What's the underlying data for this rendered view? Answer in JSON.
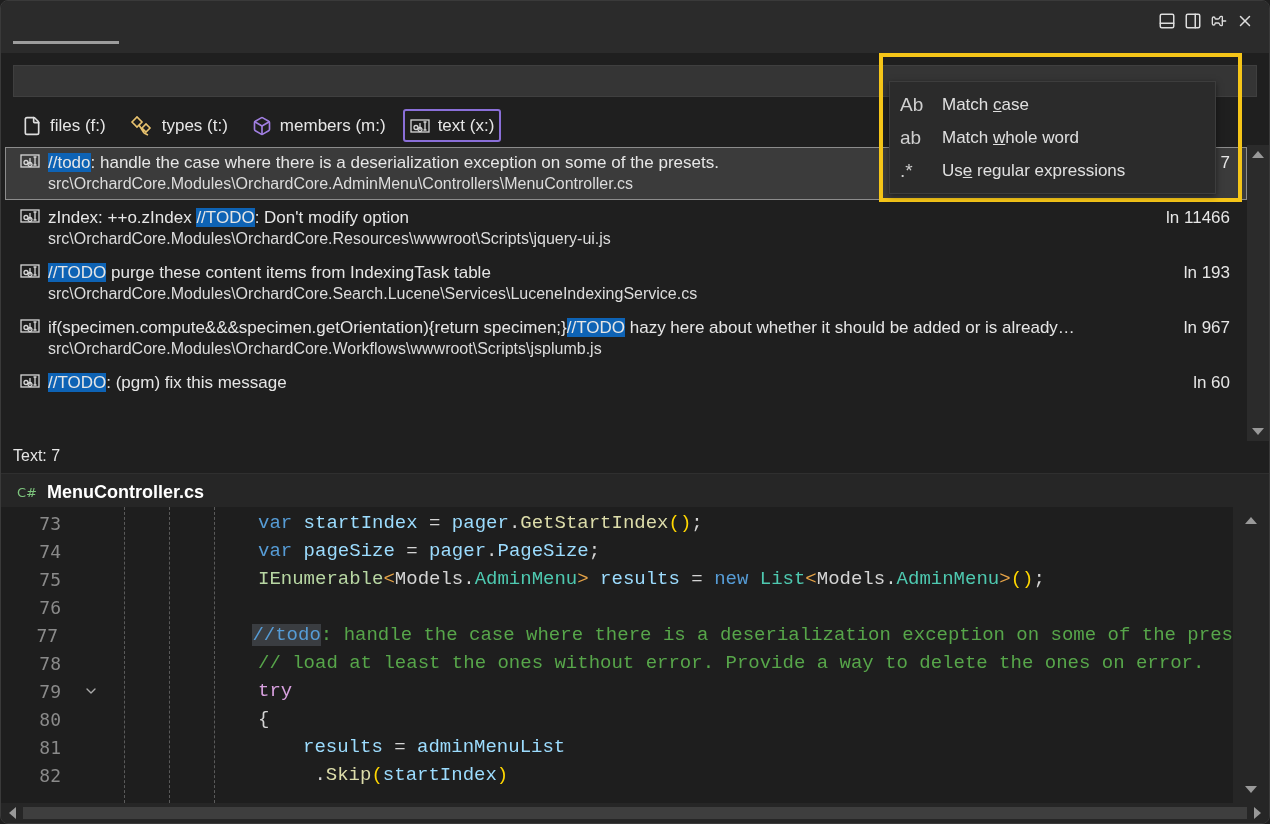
{
  "filters": [
    {
      "kind": "files",
      "label": "files (f:)",
      "selected": false
    },
    {
      "kind": "types",
      "label": "types (t:)",
      "selected": false
    },
    {
      "kind": "members",
      "label": "members (m:)",
      "selected": false
    },
    {
      "kind": "text",
      "label": "text (x:)",
      "selected": true
    }
  ],
  "results": [
    {
      "selected": true,
      "parts": [
        {
          "text": "//todo",
          "match": true
        },
        {
          "text": ": handle the case where there is a deserialization exception on some of the presets.",
          "match": false
        }
      ],
      "path": "src\\OrchardCore.Modules\\OrchardCore.AdminMenu\\Controllers\\MenuController.cs",
      "line": "7"
    },
    {
      "selected": false,
      "parts": [
        {
          "text": "zIndex: ++o.zIndex ",
          "match": false
        },
        {
          "text": "//TODO",
          "match": true
        },
        {
          "text": ": Don't modify option",
          "match": false
        }
      ],
      "path": "src\\OrchardCore.Modules\\OrchardCore.Resources\\wwwroot\\Scripts\\jquery-ui.js",
      "line": "ln 11466"
    },
    {
      "selected": false,
      "parts": [
        {
          "text": "//TODO",
          "match": true
        },
        {
          "text": " purge these content items from IndexingTask table",
          "match": false
        }
      ],
      "path": "src\\OrchardCore.Modules\\OrchardCore.Search.Lucene\\Services\\LuceneIndexingService.cs",
      "line": "ln 193"
    },
    {
      "selected": false,
      "parts": [
        {
          "text": "if(specimen.compute&&&specimen.getOrientation){return specimen;}",
          "match": false
        },
        {
          "text": "//TODO",
          "match": true
        },
        {
          "text": " hazy here about whether it should be added or is already…",
          "match": false
        }
      ],
      "path": "src\\OrchardCore.Modules\\OrchardCore.Workflows\\wwwroot\\Scripts\\jsplumb.js",
      "line": "ln 967"
    },
    {
      "selected": false,
      "parts": [
        {
          "text": "//TODO",
          "match": true
        },
        {
          "text": ": (pgm) fix this message",
          "match": false
        }
      ],
      "line": "ln 60"
    }
  ],
  "status": "Text: 7",
  "editor": {
    "icon_label": "C#",
    "file": "MenuController.cs",
    "lines": [
      {
        "number": "73",
        "fold": false,
        "tokens": [
          {
            "kind": "keyword",
            "text": "var"
          },
          {
            "kind": "local",
            "text": " startIndex"
          },
          {
            "kind": "plain",
            "text": " = "
          },
          {
            "kind": "local",
            "text": "pager"
          },
          {
            "kind": "plain",
            "text": "."
          },
          {
            "kind": "method",
            "text": "GetStartIndex"
          },
          {
            "kind": "bracket",
            "text": "()"
          },
          {
            "kind": "plain",
            "text": ";"
          }
        ]
      },
      {
        "number": "74",
        "fold": false,
        "tokens": [
          {
            "kind": "keyword",
            "text": "var"
          },
          {
            "kind": "local",
            "text": " pageSize"
          },
          {
            "kind": "plain",
            "text": " = "
          },
          {
            "kind": "local",
            "text": "pager"
          },
          {
            "kind": "plain",
            "text": "."
          },
          {
            "kind": "local",
            "text": "PageSize"
          },
          {
            "kind": "plain",
            "text": ";"
          }
        ]
      },
      {
        "number": "75",
        "fold": false,
        "tokens": [
          {
            "kind": "interface",
            "text": "IEnumerable"
          },
          {
            "kind": "angle",
            "text": "<"
          },
          {
            "kind": "plain",
            "text": "Models."
          },
          {
            "kind": "type",
            "text": "AdminMenu"
          },
          {
            "kind": "angle",
            "text": ">"
          },
          {
            "kind": "local",
            "text": " results"
          },
          {
            "kind": "plain",
            "text": " = "
          },
          {
            "kind": "keyword",
            "text": "new"
          },
          {
            "kind": "type",
            "text": " List"
          },
          {
            "kind": "angle",
            "text": "<"
          },
          {
            "kind": "plain",
            "text": "Models."
          },
          {
            "kind": "type",
            "text": "AdminMenu"
          },
          {
            "kind": "angle",
            "text": ">"
          },
          {
            "kind": "bracket",
            "text": "()"
          },
          {
            "kind": "plain",
            "text": ";"
          }
        ]
      },
      {
        "number": "76",
        "fold": false
      },
      {
        "number": "77",
        "fold": false,
        "tokens": [
          {
            "kind": "match",
            "text": "//todo"
          },
          {
            "kind": "comment",
            "text": ": handle the case where there is a deserialization exception on some of the pres"
          }
        ]
      },
      {
        "number": "78",
        "fold": false,
        "tokens": [
          {
            "kind": "comment",
            "text": "// load at least the ones without error. Provide a way to delete the ones on error."
          }
        ]
      },
      {
        "number": "79",
        "fold": true,
        "tokens": [
          {
            "kind": "control",
            "text": "try"
          }
        ]
      },
      {
        "number": "80",
        "fold": false,
        "tokens": [
          {
            "kind": "plain",
            "text": "{"
          }
        ],
        "children": [
          {
            "number": "81",
            "fold": false,
            "tokens": [
              {
                "kind": "local",
                "text": "results"
              },
              {
                "kind": "plain",
                "text": " = "
              },
              {
                "kind": "local",
                "text": "adminMenuList"
              }
            ]
          },
          {
            "number": "82",
            "fold": false,
            "tokens": [
              {
                "kind": "plain",
                "text": " ."
              },
              {
                "kind": "method",
                "text": "Skip"
              },
              {
                "kind": "bracket",
                "text": "("
              },
              {
                "kind": "local",
                "text": "startIndex"
              },
              {
                "kind": "bracket",
                "text": ")"
              }
            ]
          }
        ]
      }
    ]
  },
  "options_menu": [
    {
      "glyph": "Ab",
      "before": "Match ",
      "key": "c",
      "after": "ase"
    },
    {
      "glyph": "ab",
      "before": "Match ",
      "key": "w",
      "after": "hole word"
    },
    {
      "glyph": ".*",
      "before": "Us",
      "key": "e",
      "after": " regular expressions"
    }
  ]
}
